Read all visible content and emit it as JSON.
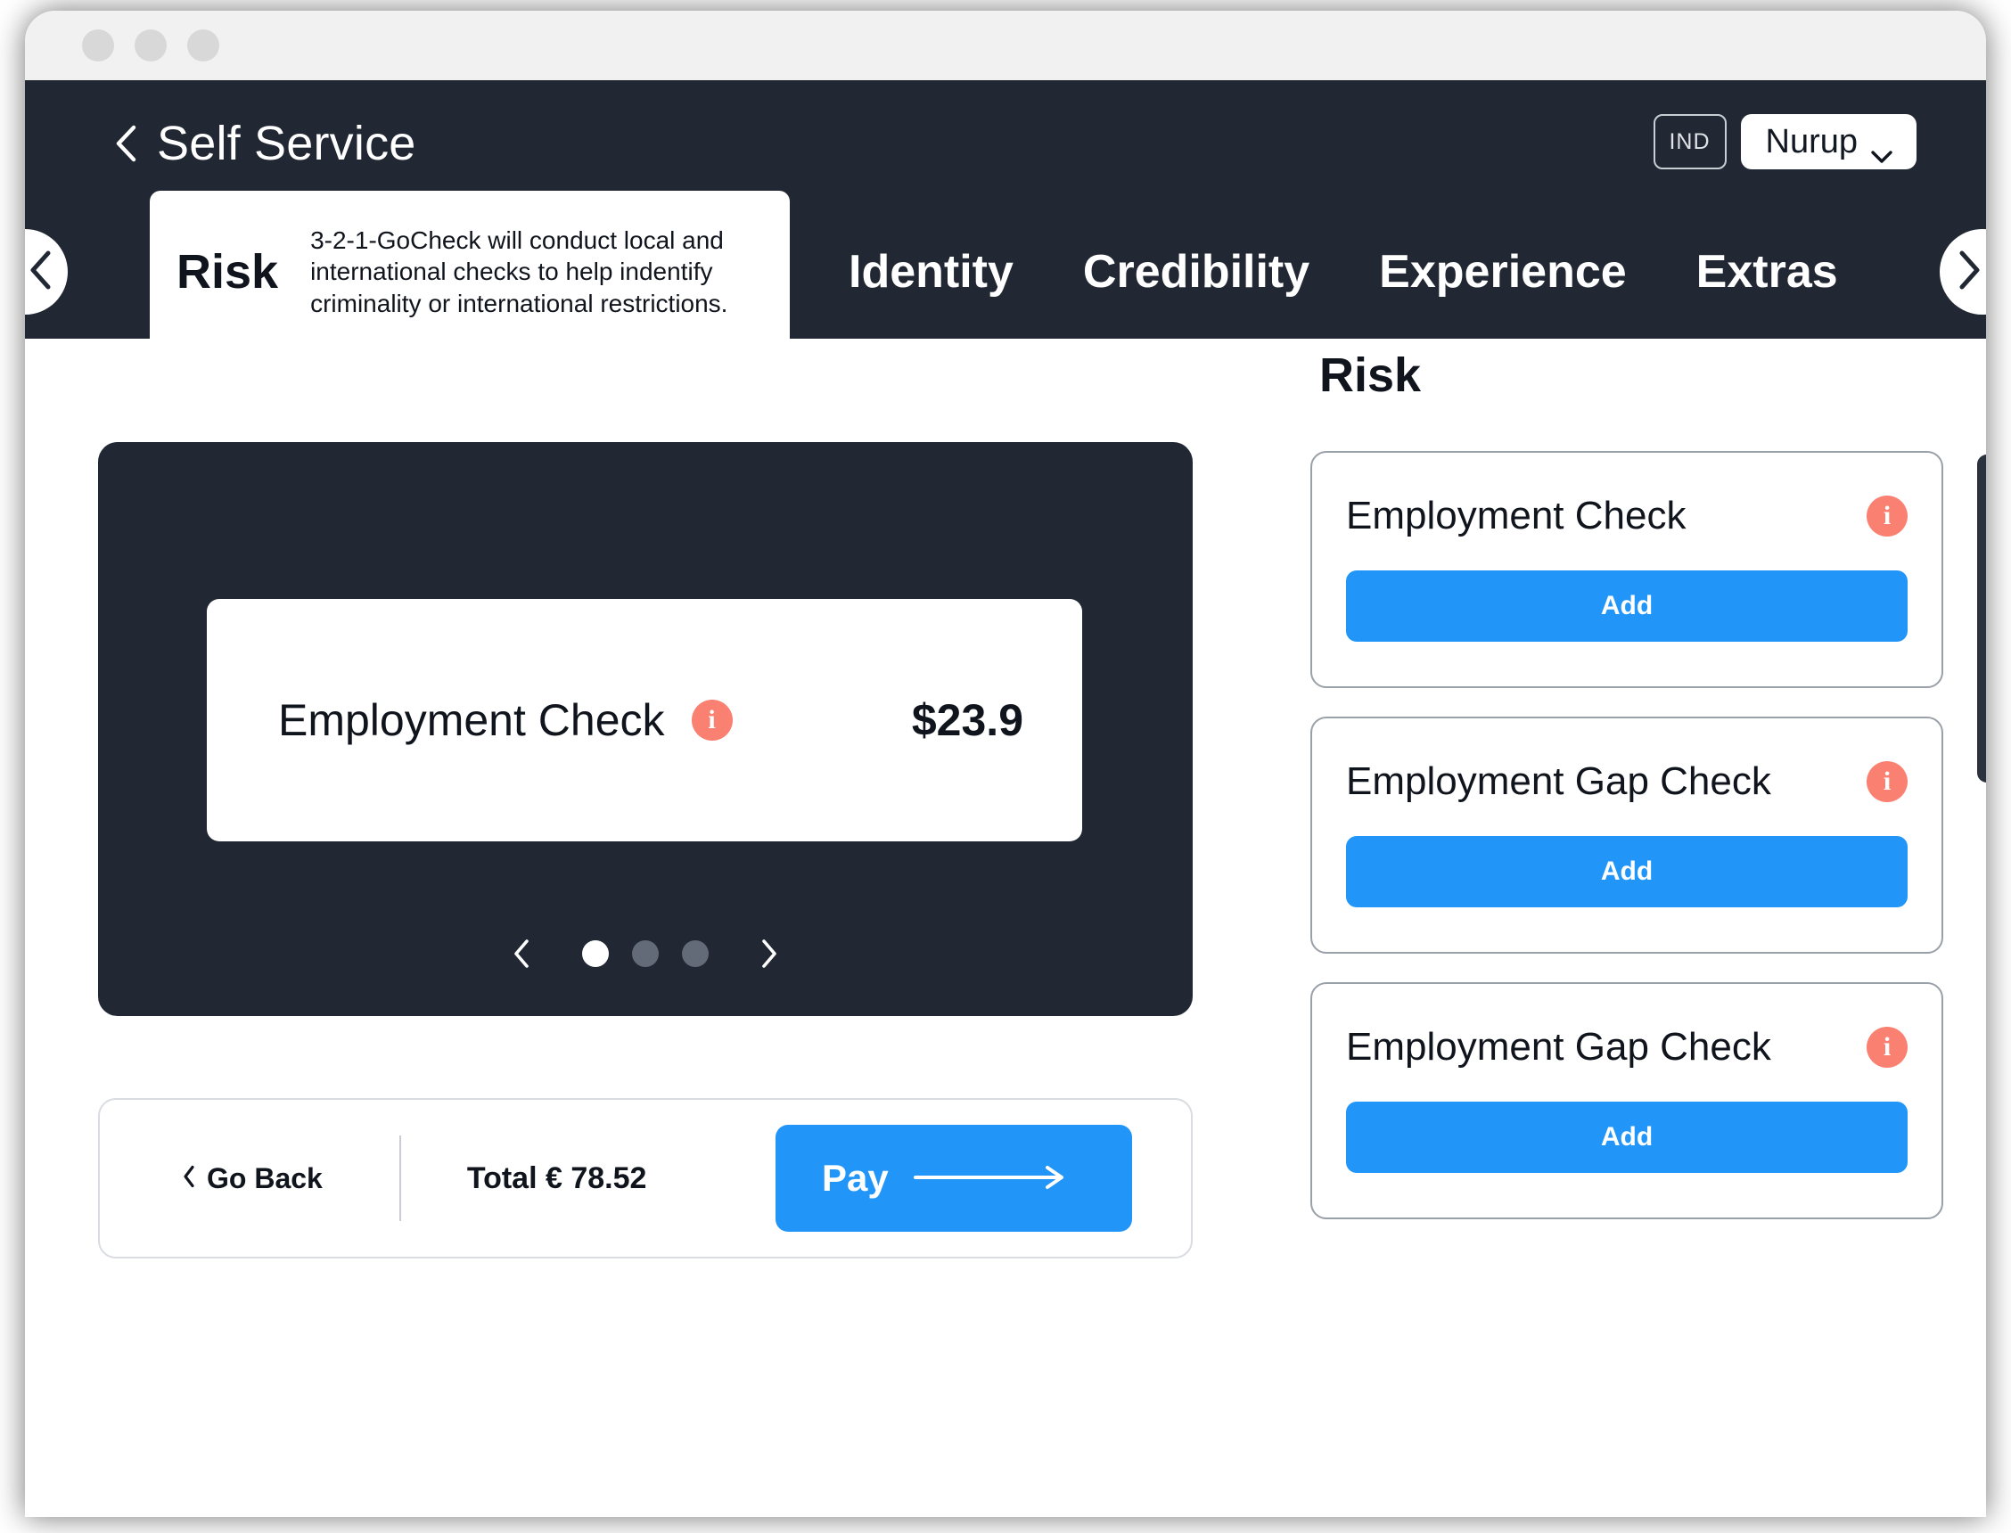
{
  "window": {
    "traffic_lights": [
      "dot-1",
      "dot-2",
      "dot-3"
    ]
  },
  "header": {
    "back_icon": "chevron-left-icon",
    "title": "Self Service",
    "country_badge": "IND",
    "account_name": "Nurup",
    "account_chevron": "chevron-down-icon"
  },
  "tabbar": {
    "prev_icon": "chevron-left-icon",
    "next_icon": "chevron-right-icon",
    "active_tab": {
      "label": "Risk",
      "description": "3-2-1-GoCheck will conduct local and international checks to help indentify criminality or international restrictions."
    },
    "tabs": [
      {
        "label": "Identity"
      },
      {
        "label": "Credibility"
      },
      {
        "label": "Experience"
      },
      {
        "label": "Extras"
      }
    ]
  },
  "cart": {
    "item": {
      "name": "Employment Check",
      "info_icon": "info-icon",
      "price": "$23.9"
    },
    "carousel": {
      "prev_icon": "chevron-left-icon",
      "next_icon": "chevron-right-icon",
      "total_slides": 3,
      "active_slide": 1
    }
  },
  "checkout": {
    "go_back_icon": "chevron-left-icon",
    "go_back_label": "Go Back",
    "total_label": "Total  € 78.52",
    "pay_label": "Pay",
    "pay_arrow_icon": "arrow-right-icon"
  },
  "panel": {
    "title": "Risk",
    "cards": [
      {
        "title": "Employment Check",
        "info_icon": "info-icon",
        "add_label": "Add"
      },
      {
        "title": "Employment Gap Check",
        "info_icon": "info-icon",
        "add_label": "Add"
      },
      {
        "title": "Employment Gap Check",
        "info_icon": "info-icon",
        "add_label": "Add"
      }
    ]
  },
  "colors": {
    "dark": "#212833",
    "accent_blue": "#2196f8",
    "info_salmon": "#fa8072",
    "titlebar": "#f1f1f1"
  },
  "icons": {
    "info_glyph": "i"
  }
}
